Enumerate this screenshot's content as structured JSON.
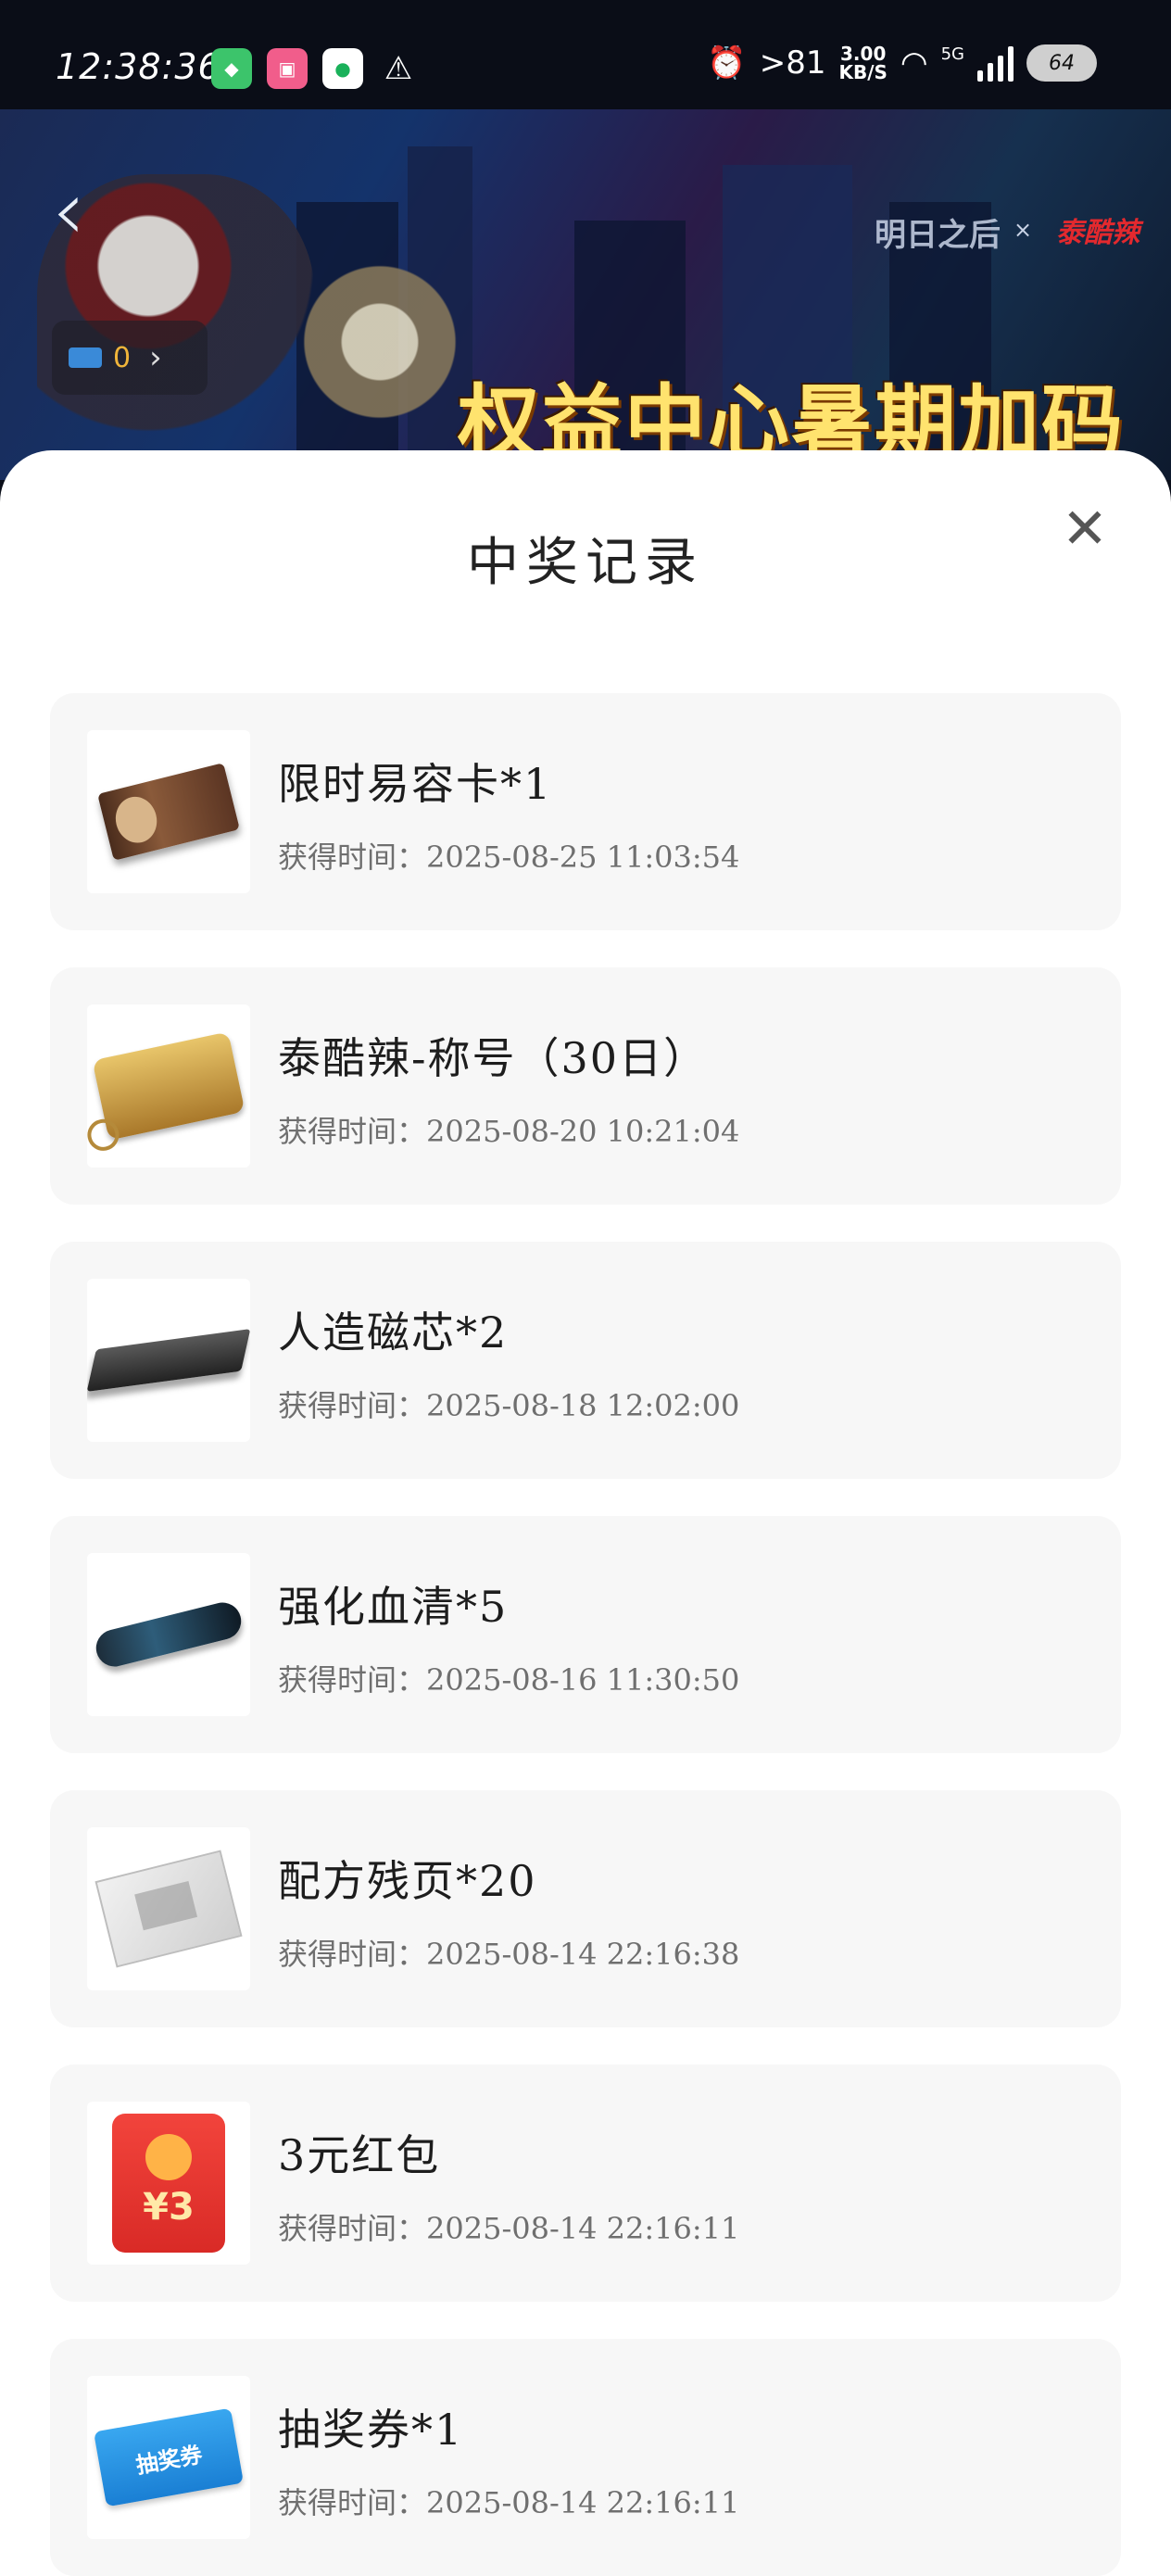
{
  "status_bar": {
    "time": "12:38:36",
    "signal_strength": ">81",
    "net_speed_value": "3.00",
    "net_speed_unit": "KB/S",
    "network_type": "5G",
    "battery": "64"
  },
  "banner": {
    "coin_count": "0",
    "brand_left": "明日之后",
    "brand_separator": "×",
    "brand_right": "泰酷辣",
    "title": "权益中心暑期加码"
  },
  "sheet": {
    "title": "中奖记录",
    "time_prefix": "获得时间："
  },
  "records": [
    {
      "name": "限时易容卡*1",
      "time": "获得时间：2025-08-25 11:03:54",
      "thumb": "disguise-card"
    },
    {
      "name": "泰酷辣-称号（30日）",
      "time": "获得时间：2025-08-20 10:21:04",
      "thumb": "title-tag"
    },
    {
      "name": "人造磁芯*2",
      "time": "获得时间：2025-08-18 12:02:00",
      "thumb": "magnetic-core"
    },
    {
      "name": "强化血清*5",
      "time": "获得时间：2025-08-16 11:30:50",
      "thumb": "serum"
    },
    {
      "name": "配方残页*20",
      "time": "获得时间：2025-08-14 22:16:38",
      "thumb": "recipe-page"
    },
    {
      "name": "3元红包",
      "time": "获得时间：2025-08-14 22:16:11",
      "thumb": "red-packet",
      "thumb_text": "¥3"
    },
    {
      "name": "抽奖券*1",
      "time": "获得时间：2025-08-14 22:16:11",
      "thumb": "lottery-ticket",
      "thumb_text": "抽奖券"
    }
  ]
}
